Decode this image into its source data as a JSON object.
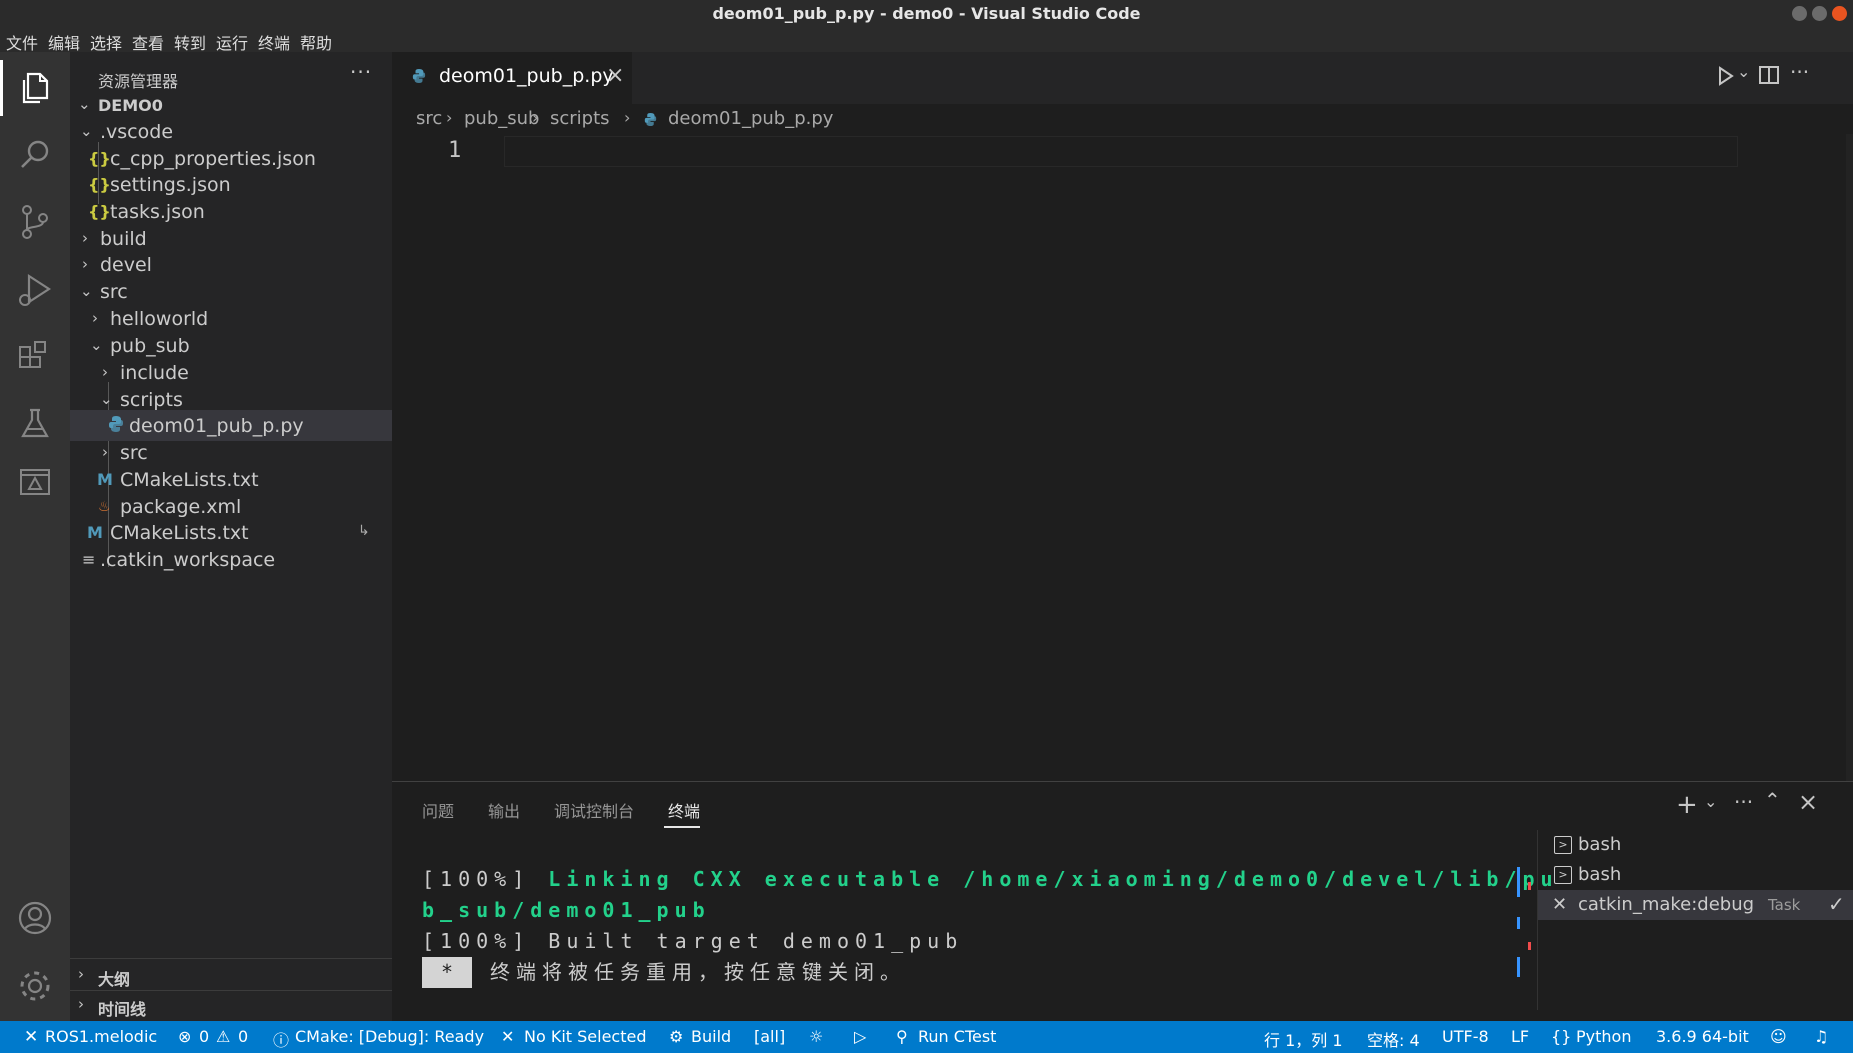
{
  "window": {
    "title": "deom01_pub_p.py - demo0 - Visual Studio Code"
  },
  "menu": [
    "文件",
    "编辑",
    "选择",
    "查看",
    "转到",
    "运行",
    "终端",
    "帮助"
  ],
  "activity_bar": [
    "files-icon",
    "search-icon",
    "source-control-icon",
    "run-debug-icon",
    "extensions-icon",
    "testing-icon",
    "remote-explorer-icon",
    "account-icon",
    "settings-gear-icon"
  ],
  "sidebar": {
    "title": "资源管理器",
    "more": "···",
    "root": "DEMO0",
    "tree": [
      {
        "label": ".vscode",
        "type": "folder-open"
      },
      {
        "label": "c_cpp_properties.json",
        "type": "json"
      },
      {
        "label": "settings.json",
        "type": "json"
      },
      {
        "label": "tasks.json",
        "type": "json"
      },
      {
        "label": "build",
        "type": "folder"
      },
      {
        "label": "devel",
        "type": "folder"
      },
      {
        "label": "src",
        "type": "folder-open"
      },
      {
        "label": "helloworld",
        "type": "folder"
      },
      {
        "label": "pub_sub",
        "type": "folder-open"
      },
      {
        "label": "include",
        "type": "folder"
      },
      {
        "label": "scripts",
        "type": "folder-open"
      },
      {
        "label": "deom01_pub_p.py",
        "type": "python"
      },
      {
        "label": "src",
        "type": "folder"
      },
      {
        "label": "CMakeLists.txt",
        "type": "cmake"
      },
      {
        "label": "package.xml",
        "type": "xml"
      },
      {
        "label": "CMakeLists.txt",
        "type": "cmake"
      },
      {
        "label": ".catkin_workspace",
        "type": "text"
      }
    ],
    "outline": "大纲",
    "timeline": "时间线"
  },
  "editor": {
    "tab_label": "deom01_pub_p.py",
    "breadcrumb": [
      "src",
      "pub_sub",
      "scripts",
      "deom01_pub_p.py"
    ],
    "line_number": "1"
  },
  "panel": {
    "tabs": [
      "问题",
      "输出",
      "调试控制台",
      "终端"
    ],
    "active_tab": "终端",
    "terminal": {
      "line1_prefix": "[100%] ",
      "line1_green": "Linking CXX executable /home/xiaoming/demo0/devel/lib/pu",
      "line2_green": "b_sub/demo01_pub",
      "line3": "[100%] Built target demo01_pub",
      "cursor": "*",
      "line4": " 终端将被任务重用，按任意键关闭。"
    },
    "terminals": [
      {
        "label": "bash",
        "desc": ""
      },
      {
        "label": "bash",
        "desc": ""
      },
      {
        "label": "catkin_make:debug",
        "desc": "Task"
      }
    ]
  },
  "statusbar": {
    "remote": "ROS1.melodic",
    "errors": "0",
    "warnings": "0",
    "cmake": "CMake: [Debug]: Ready",
    "kit": "No Kit Selected",
    "build": "Build",
    "target": "[all]",
    "ctest": "Run CTest",
    "position": "行 1，列 1",
    "spaces": "空格: 4",
    "encoding": "UTF-8",
    "eol": "LF",
    "language": "Python",
    "interpreter": "3.6.9 64-bit"
  },
  "colors": {
    "accent": "#007acc",
    "terminal_green": "#23d18b",
    "close_button": "#e95420"
  }
}
